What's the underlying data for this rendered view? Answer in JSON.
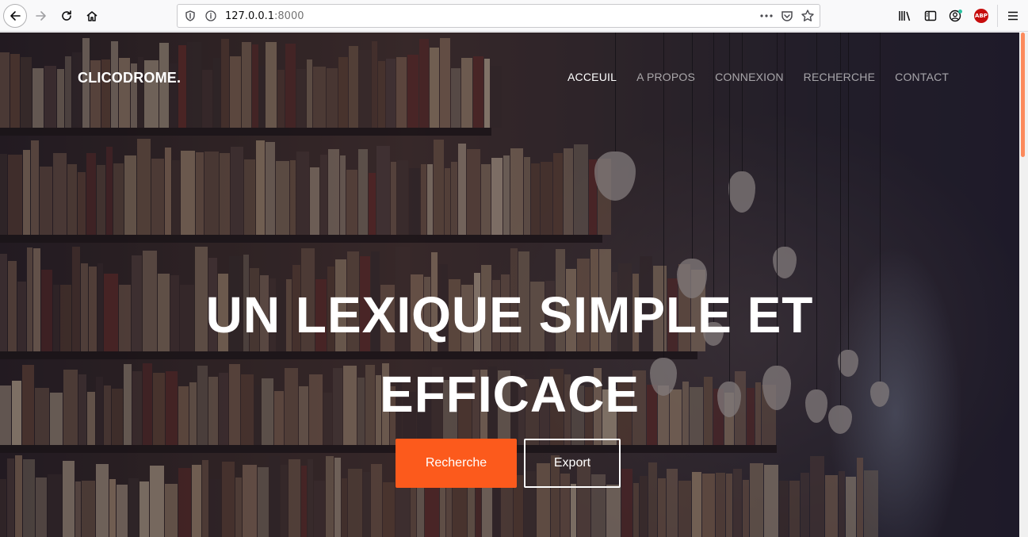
{
  "browser": {
    "url_host": "127.0.0.1",
    "url_port": ":8000"
  },
  "site": {
    "brand": "CLICODROME.",
    "nav": [
      {
        "label": "ACCEUIL"
      },
      {
        "label": "A PROPOS"
      },
      {
        "label": "CONNEXION"
      },
      {
        "label": "RECHERCHE"
      },
      {
        "label": "CONTACT"
      }
    ]
  },
  "hero": {
    "title_line1": "UN LEXIQUE SIMPLE ET",
    "title_line2": "EFFICACE",
    "primary_button": "Recherche",
    "secondary_button": "Export"
  },
  "colors": {
    "accent": "#fc5a1c",
    "abp_badge": "#c70d0d"
  },
  "icons": {
    "back": "arrow-left-icon",
    "forward": "arrow-right-icon",
    "reload": "reload-icon",
    "home": "home-icon",
    "abp": "ABP"
  }
}
